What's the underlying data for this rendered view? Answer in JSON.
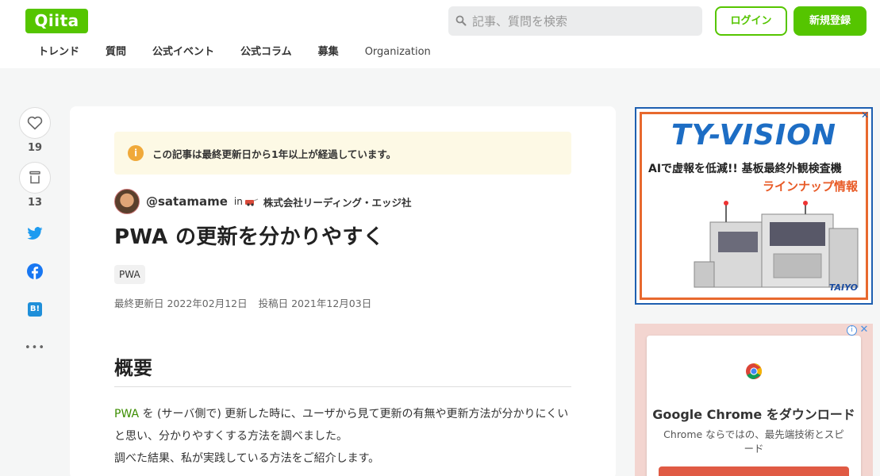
{
  "header": {
    "logo": "Qiita",
    "search_placeholder": "記事、質問を検索",
    "login_label": "ログイン",
    "signup_label": "新規登録",
    "nav": [
      "トレンド",
      "質問",
      "公式イベント",
      "公式コラム",
      "募集",
      "Organization"
    ]
  },
  "rail": {
    "like_count": "19",
    "stock_count": "13",
    "hatena_label": "B!",
    "more_label": "•••"
  },
  "article": {
    "notice": "この記事は最終更新日から1年以上が経過しています。",
    "author": "@satamame",
    "in_label": "in",
    "organization": "株式会社リーディング・エッジ社",
    "title": "PWA の更新を分かりやすく",
    "tag": "PWA",
    "updated": "最終更新日 2022年02月12日",
    "posted": "投稿日 2021年12月03日",
    "heading": "概要",
    "link_text": "PWA",
    "para1_rest": " を (サーバ側で) 更新した時に、ユーザから見て更新の有無や更新方法が分かりにくいと思い、分かりやすくする方法を調べました。",
    "para2": "調べた結果、私が実践している方法をご紹介します。"
  },
  "ads": {
    "ad1": {
      "brand": "TY-VISION",
      "line1": "AIで虚報を低減!! 基板最終外観検査機",
      "line2": "ラインナップ情報",
      "maker": "TAIYO"
    },
    "ad2": {
      "heading": "Google Chrome をダウンロード",
      "text": "Chrome ならではの、最先端技術とスピード"
    }
  },
  "colors": {
    "brand_green": "#55c500",
    "link_green": "#3b8d00",
    "notice_bg": "#fdf9e5",
    "notice_icon": "#f0a93a"
  }
}
